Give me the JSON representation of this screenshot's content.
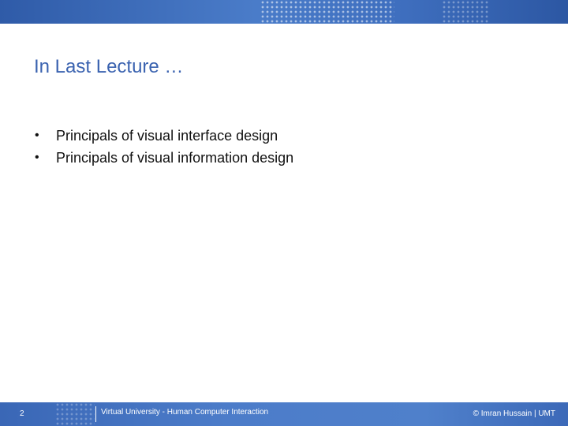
{
  "slide": {
    "title": "In Last Lecture …",
    "bullets": [
      "Principals of visual interface design",
      "Principals of visual information design"
    ],
    "bullet_symbol": "•",
    "page_number": "2",
    "footer_center": "Virtual University - Human Computer Interaction",
    "footer_right": "© Imran Hussain | UMT"
  },
  "colors": {
    "title": "#3b63b0",
    "band": "#4a7cc9",
    "text": "#111111"
  }
}
